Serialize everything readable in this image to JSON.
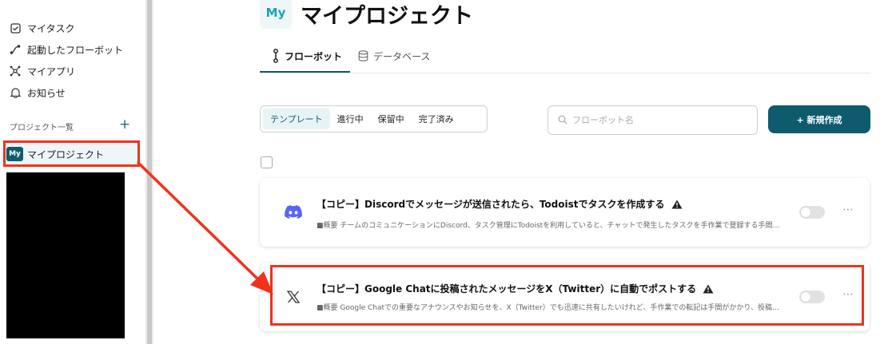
{
  "sidebar": {
    "nav": [
      {
        "label": "マイタスク",
        "icon": "checkbox-icon"
      },
      {
        "label": "起動したフローボット",
        "icon": "flow-icon"
      },
      {
        "label": "マイアプリ",
        "icon": "apps-icon"
      },
      {
        "label": "お知らせ",
        "icon": "bell-icon"
      }
    ],
    "projects_label": "プロジェクト一覧",
    "add_icon": "+",
    "project": {
      "badge": "My",
      "name": "マイプロジェクト"
    }
  },
  "header": {
    "badge": "My",
    "title": "マイプロジェクト"
  },
  "tabs": [
    {
      "label": "フローボット",
      "icon": "flowbot-icon",
      "active": true
    },
    {
      "label": "データベース",
      "icon": "database-icon",
      "active": false
    }
  ],
  "filters": [
    {
      "label": "テンプレート",
      "active": true
    },
    {
      "label": "進行中",
      "active": false
    },
    {
      "label": "保留中",
      "active": false
    },
    {
      "label": "完了済み",
      "active": false
    }
  ],
  "search": {
    "placeholder": "フローボット名"
  },
  "new_button": "+ 新規作成",
  "cards": [
    {
      "icon": "discord-icon",
      "title": "【コピー】Discordでメッセージが送信されたら、Todoistでタスクを作成する",
      "desc": "■概要 チームのコミュニケーションにDiscord、タスク管理にTodoistを利用していると、チャットで発生したタスクを手作業で登録する手間…",
      "more": "⋯"
    },
    {
      "icon": "x-twitter-icon",
      "title": "【コピー】Google Chatに投稿されたメッセージをX（Twitter）に自動でポストする",
      "desc": "■概要 Google Chatでの重要なアナウンスやお知らせを、X（Twitter）でも迅速に共有したいけれど、手作業での転記は手間がかかり、投稿…",
      "more": "⋯"
    }
  ],
  "colors": {
    "accent": "#0e5b6e",
    "highlight": "#f0321c"
  }
}
